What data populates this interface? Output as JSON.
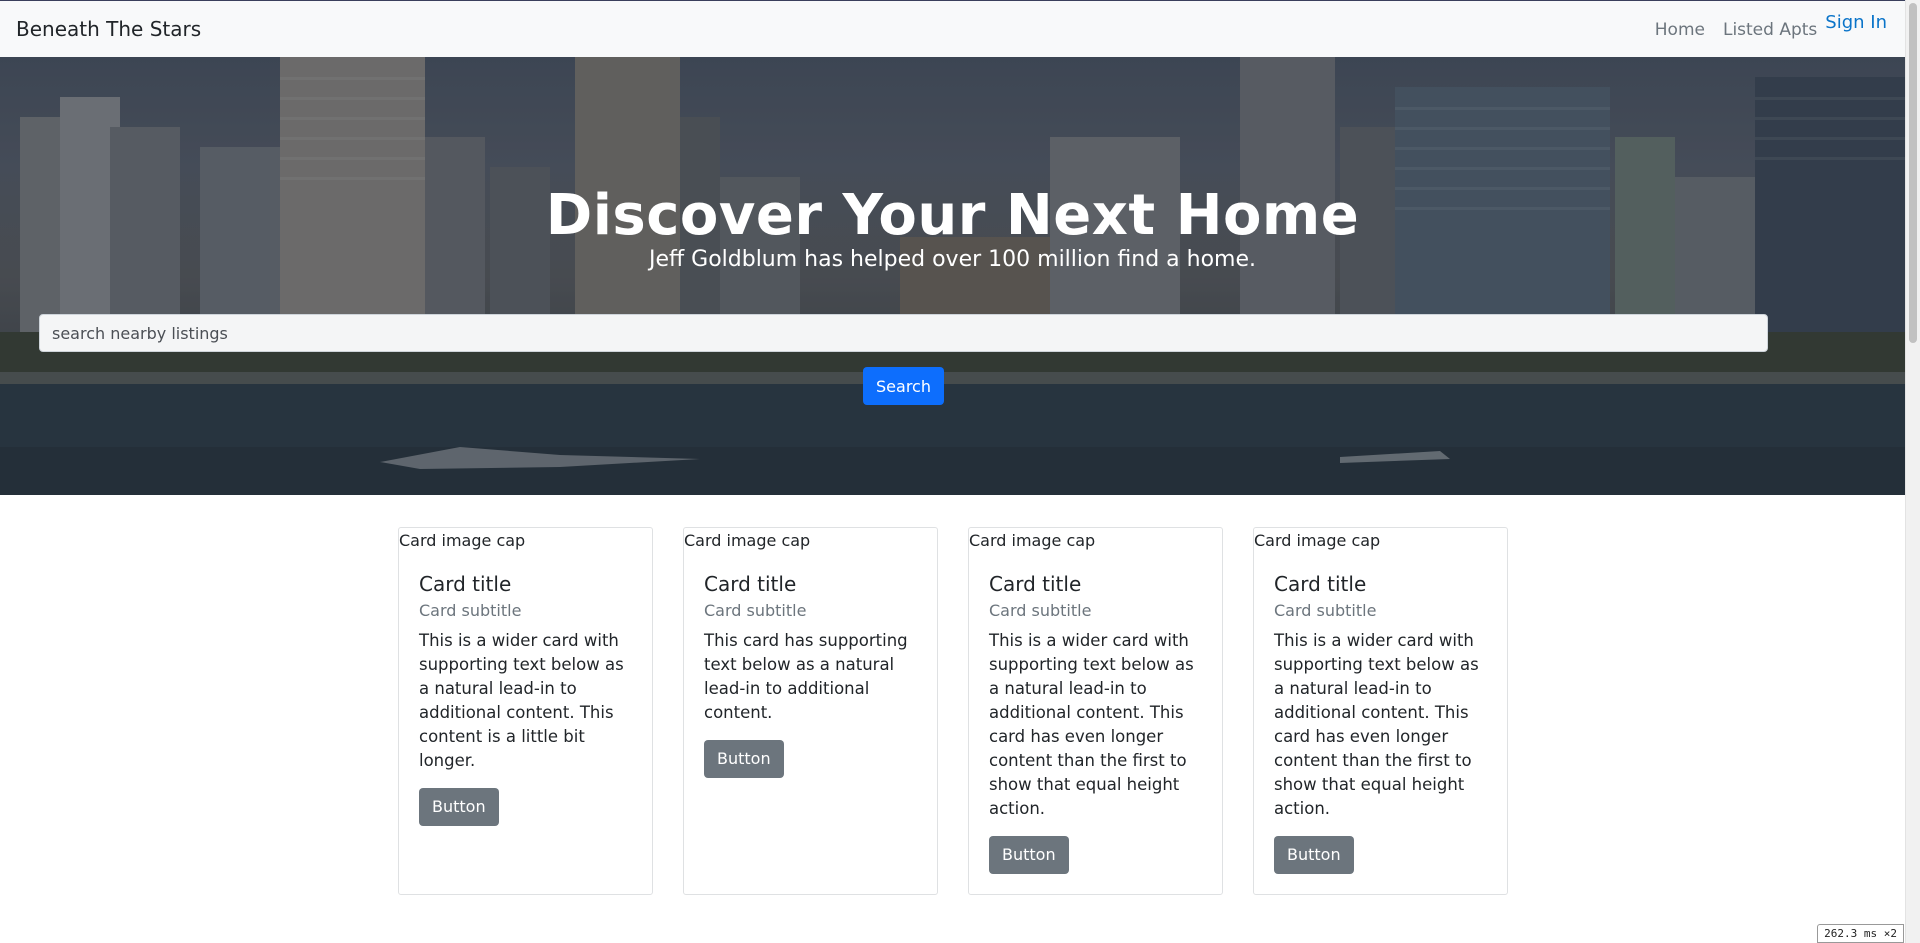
{
  "navbar": {
    "brand": "Beneath The Stars",
    "links": [
      "Home",
      "Listed Apts"
    ],
    "sign_in": "Sign In"
  },
  "hero": {
    "title": "Discover Your Next Home",
    "subtitle": "Jeff Goldblum has helped over 100 million find a home.",
    "search_placeholder": "search nearby listings",
    "search_button": "Search"
  },
  "cards": [
    {
      "image_alt": "Card image cap",
      "title": "Card title",
      "subtitle": "Card subtitle",
      "text": "This is a wider card with supporting text below as a natural lead-in to additional content. This content is a little bit longer.",
      "button": "Button"
    },
    {
      "image_alt": "Card image cap",
      "title": "Card title",
      "subtitle": "Card subtitle",
      "text": "This card has supporting text below as a natural lead-in to additional content.",
      "button": "Button"
    },
    {
      "image_alt": "Card image cap",
      "title": "Card title",
      "subtitle": "Card subtitle",
      "text": "This is a wider card with supporting text below as a natural lead-in to additional content. This card has even longer content than the first to show that equal height action.",
      "button": "Button"
    },
    {
      "image_alt": "Card image cap",
      "title": "Card title",
      "subtitle": "Card subtitle",
      "text": "This is a wider card with supporting text below as a natural lead-in to additional content. This card has even longer content than the first to show that equal height action.",
      "button": "Button"
    }
  ],
  "perf_overlay": "262.3 ms ×2",
  "colors": {
    "primary": "#0d6efd",
    "secondary": "#6c757d",
    "link": "#0a74c9",
    "navbar_bg": "#f8f9fa"
  }
}
